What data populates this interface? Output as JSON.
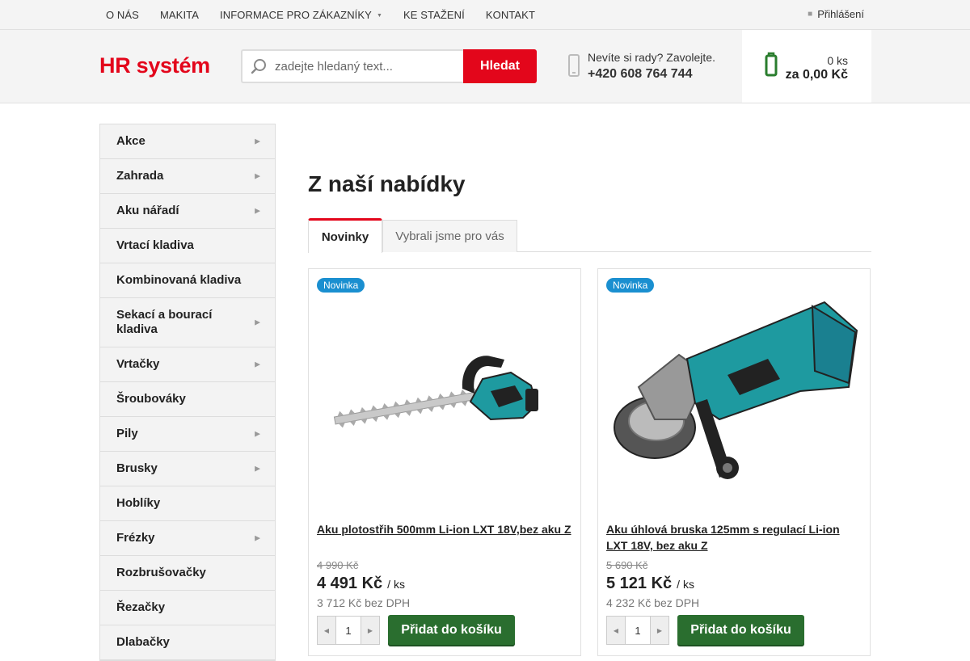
{
  "topnav": {
    "items": [
      "O NÁS",
      "MAKITA",
      "INFORMACE PRO ZÁKAZNÍKY",
      "KE STAŽENÍ",
      "KONTAKT"
    ],
    "login": "Přihlášení"
  },
  "header": {
    "logo": "HR systém",
    "search": {
      "placeholder": "zadejte hledaný text...",
      "button": "Hledat"
    },
    "contact": {
      "question": "Nevíte si rady? Zavolejte.",
      "phone": "+420 608 764 744"
    },
    "cart": {
      "quantity": "0 ks",
      "total": "za 0,00 Kč"
    }
  },
  "sidebar": {
    "categories": [
      {
        "label": "Akce",
        "has_sub": true
      },
      {
        "label": "Zahrada",
        "has_sub": true
      },
      {
        "label": "Aku nářadí",
        "has_sub": true
      },
      {
        "label": "Vrtací kladiva",
        "has_sub": false
      },
      {
        "label": "Kombinovaná kladiva",
        "has_sub": false
      },
      {
        "label": "Sekací a bourací kladiva",
        "has_sub": true
      },
      {
        "label": "Vrtačky",
        "has_sub": true
      },
      {
        "label": "Šroubováky",
        "has_sub": false
      },
      {
        "label": "Pily",
        "has_sub": true
      },
      {
        "label": "Brusky",
        "has_sub": true
      },
      {
        "label": "Hoblíky",
        "has_sub": false
      },
      {
        "label": "Frézky",
        "has_sub": true
      },
      {
        "label": "Rozbrušovačky",
        "has_sub": false
      },
      {
        "label": "Řezačky",
        "has_sub": false
      },
      {
        "label": "Dlabačky",
        "has_sub": false
      }
    ]
  },
  "main": {
    "heading": "Z naší nabídky",
    "tabs": [
      "Novinky",
      "Vybrali jsme pro vás"
    ],
    "products": [
      {
        "badge": "Novinka",
        "name": "Aku plotostřih 500mm Li-ion LXT 18V,bez aku Z",
        "old_price": "4 990 Kč",
        "price": "4 491 Kč",
        "unit": "/ ks",
        "net_price": "3 712 Kč bez DPH",
        "qty": "1",
        "add_label": "Přidat do košíku"
      },
      {
        "badge": "Novinka",
        "name": "Aku úhlová bruska 125mm s regulací Li-ion LXT 18V, bez aku Z",
        "old_price": "5 690 Kč",
        "price": "5 121 Kč",
        "unit": "/ ks",
        "net_price": "4 232 Kč bez DPH",
        "qty": "1",
        "add_label": "Přidat do košíku"
      }
    ]
  },
  "colors": {
    "brand_red": "#e3061b",
    "cart_green": "#2a6e2f",
    "badge_blue": "#1a8fd0"
  }
}
